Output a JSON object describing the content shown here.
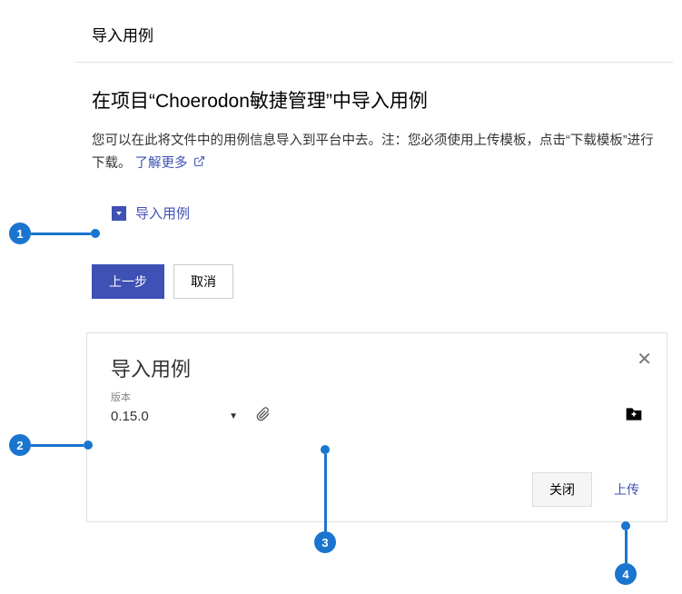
{
  "panel1": {
    "header_title": "导入用例",
    "heading": "在项目“Choerodon敏捷管理”中导入用例",
    "description_part1": "您可以在此将文件中的用例信息导入到平台中去。注：您必须使用上传模板，点击“下载模板”进行下载。",
    "learn_more": "了解更多",
    "import_link": "导入用例",
    "prev_button": "上一步",
    "cancel_button": "取消"
  },
  "panel2": {
    "title": "导入用例",
    "version_label": "版本",
    "version_value": "0.15.0",
    "close_button": "关闭",
    "upload_button": "上传"
  },
  "callouts": {
    "c1": "1",
    "c2": "2",
    "c3": "3",
    "c4": "4"
  }
}
